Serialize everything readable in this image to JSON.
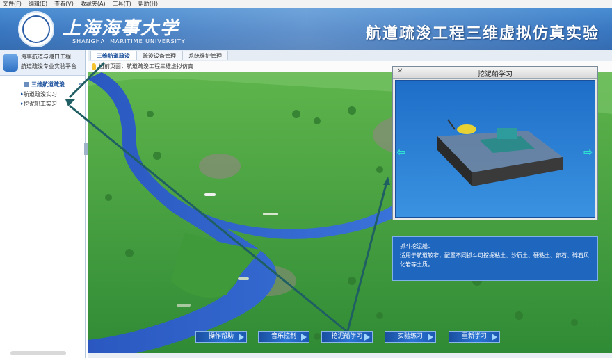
{
  "menu": {
    "items": [
      "文件(F)",
      "编辑(E)",
      "查看(V)",
      "收藏夹(A)",
      "工具(T)",
      "帮助(H)"
    ]
  },
  "header": {
    "school_name_cn": "上海海事大学",
    "school_name_en": "SHANGHAI MARITIME UNIVERSITY",
    "app_title": "航道疏浚工程三维虚拟仿真实验"
  },
  "sidebar": {
    "user_line1": "海事航道与港口工程",
    "user_line2": "航道疏浚专业实验平台",
    "tree_root": "三维航道疏浚",
    "tree_toggle": "«",
    "items": [
      {
        "label": "航道疏浚实习"
      },
      {
        "label": "挖泥船工实习"
      }
    ]
  },
  "tabs": [
    {
      "label": "三维航道疏浚",
      "active": true
    },
    {
      "label": "疏浚设备管理",
      "active": false
    },
    {
      "label": "系统维护管理",
      "active": false
    }
  ],
  "hint": {
    "text": "当前页面：航道疏浚工程三维虚拟仿真"
  },
  "popup": {
    "title": "挖泥船学习",
    "close_icon": "close-icon",
    "prev_icon": "left-arrow-icon",
    "next_icon": "right-arrow-icon"
  },
  "info": {
    "title": "抓斗挖泥船：",
    "text": "适用于航道较窄，配置不同抓斗可挖掘粘土、沙质土、硬粘土、卵石、碎石风化岩等土质。"
  },
  "bottom_buttons": [
    {
      "label": "操作帮助"
    },
    {
      "label": "音乐控制"
    },
    {
      "label": "挖泥船学习"
    },
    {
      "label": "实验练习"
    },
    {
      "label": "重新学习"
    }
  ],
  "colors": {
    "banner": "#2e6fbd",
    "button": "#2a75d4",
    "popup_body": "#1e6ec8",
    "river": "#2f62c7",
    "terrain": "#3f9a3a"
  }
}
